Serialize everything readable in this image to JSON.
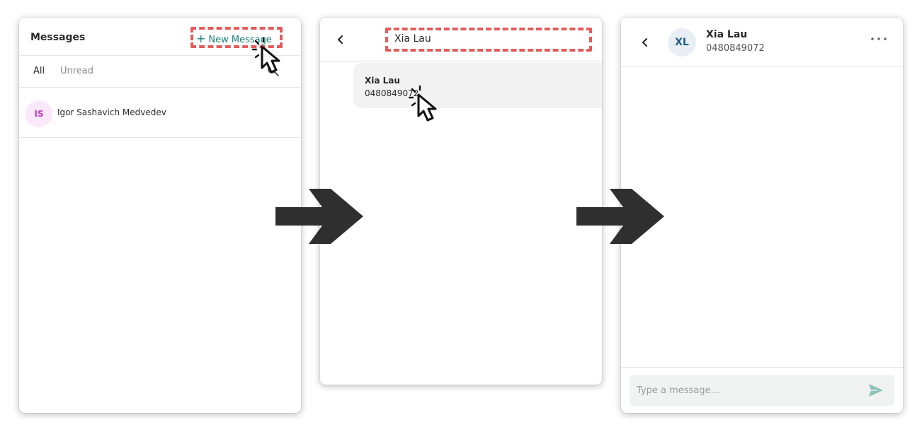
{
  "messages_panel": {
    "title": "Messages",
    "new_message_label": "New Message",
    "tabs": [
      {
        "label": "All",
        "active": true
      },
      {
        "label": "Unread",
        "active": false
      }
    ],
    "conversations": [
      {
        "initials": "IS",
        "name": "Igor Sashavich Medvedev"
      }
    ]
  },
  "search_panel": {
    "query": "Xia Lau",
    "results": [
      {
        "name": "Xia Lau",
        "phone": "0480849072"
      }
    ]
  },
  "chat_panel": {
    "contact_initials": "XL",
    "contact_name": "Xia Lau",
    "contact_phone": "0480849072",
    "composer_placeholder": "Type a message..."
  },
  "colors": {
    "accent": "#1a7f7a",
    "highlight": "#e35b5b",
    "arrow": "#2f2f2f",
    "send": "#8cc3b9"
  },
  "icons": [
    "back-icon",
    "search-icon",
    "more-icon",
    "send-icon",
    "arrow-right-icon",
    "cursor-icon"
  ]
}
